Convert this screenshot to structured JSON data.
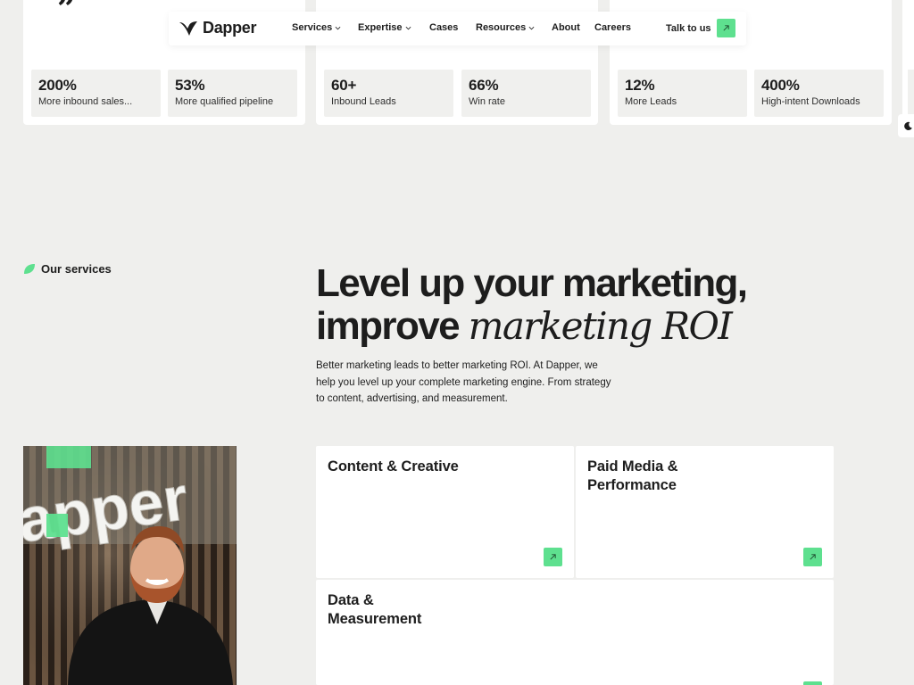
{
  "colors": {
    "accent": "#5ee08f",
    "background": "#efefed",
    "card": "#ffffff",
    "text": "#1d1d1d"
  },
  "nav": {
    "logo_text": "Dapper",
    "items": [
      {
        "label": "Services",
        "has_dropdown": true
      },
      {
        "label": "Expertise",
        "has_dropdown": true
      },
      {
        "label": "Cases",
        "has_dropdown": false
      },
      {
        "label": "Resources",
        "has_dropdown": true
      },
      {
        "label": "About",
        "has_dropdown": false
      },
      {
        "label": "Careers",
        "has_dropdown": false
      }
    ],
    "cta_label": "Talk to us",
    "cta_icon": "arrow-up-right-icon"
  },
  "cases": [
    {
      "stats": [
        {
          "value": "200%",
          "label": "More inbound sales..."
        },
        {
          "value": "53%",
          "label": "More qualified pipeline"
        }
      ]
    },
    {
      "stats": [
        {
          "value": "60+",
          "label": "Inbound Leads"
        },
        {
          "value": "66%",
          "label": "Win rate"
        }
      ]
    },
    {
      "stats": [
        {
          "value": "12%",
          "label": "More Leads"
        },
        {
          "value": "400%",
          "label": "High-intent Downloads"
        }
      ]
    }
  ],
  "theme_toggle_icon": "moon-icon",
  "services": {
    "section_label": "Our services",
    "headline_line1": "Level up your marketing,",
    "headline_line2_plain": "improve",
    "headline_line2_italic": "marketing ROI",
    "intro": "Better marketing leads to better marketing ROI. At Dapper, we help you level up your complete marketing engine. From strategy to content, advertising, and measurement.",
    "cards": [
      {
        "title": "Content & Creative"
      },
      {
        "title": "Paid Media & Performance"
      },
      {
        "title": "Data & Measurement"
      }
    ]
  },
  "photo": {
    "sign_text": "apper",
    "description_icon": "team-member-photo"
  }
}
